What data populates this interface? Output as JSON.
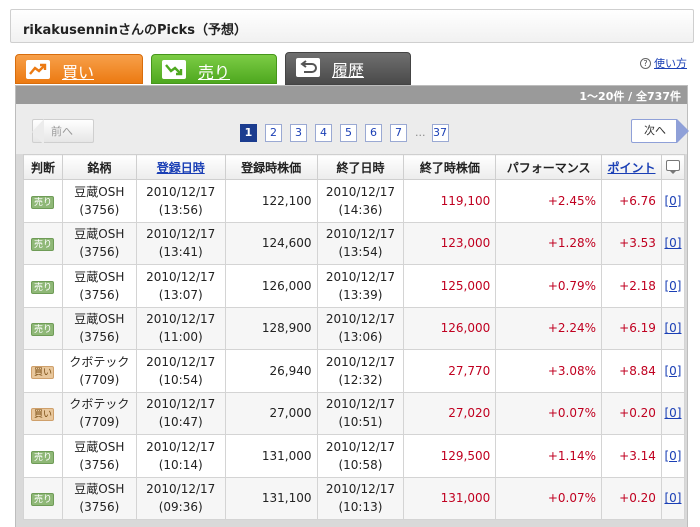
{
  "page_title": "rikakusenninさんのPicks（予想）",
  "tabs": [
    {
      "label": "買い",
      "icon": "trend-up-icon"
    },
    {
      "label": "売り",
      "icon": "trend-down-icon"
    },
    {
      "label": "履歴",
      "icon": "history-return-icon"
    }
  ],
  "howto_label": "使い方",
  "result_count": "1～20件 / 全737件",
  "pager": {
    "prev_label": "前へ",
    "next_label": "次へ",
    "pages": [
      "1",
      "2",
      "3",
      "4",
      "5",
      "6",
      "7"
    ],
    "ellipsis": "...",
    "last_page": "37",
    "current_page": "1"
  },
  "table": {
    "headers": [
      "判断",
      "銘柄",
      "登録日時",
      "登録時株価",
      "終了日時",
      "終了時株価",
      "パフォーマンス",
      "ポイント",
      ""
    ],
    "rows": [
      {
        "judgment": "売り",
        "type": "sell",
        "name": "豆蔵OSH",
        "code": "(3756)",
        "reg_date": "2010/12/17",
        "reg_time": "(13:56)",
        "reg_price": "122,100",
        "end_date": "2010/12/17",
        "end_time": "(14:36)",
        "end_price": "119,100",
        "performance": "+2.45%",
        "points": "+6.76",
        "comments": "[0]"
      },
      {
        "judgment": "売り",
        "type": "sell",
        "name": "豆蔵OSH",
        "code": "(3756)",
        "reg_date": "2010/12/17",
        "reg_time": "(13:41)",
        "reg_price": "124,600",
        "end_date": "2010/12/17",
        "end_time": "(13:54)",
        "end_price": "123,000",
        "performance": "+1.28%",
        "points": "+3.53",
        "comments": "[0]"
      },
      {
        "judgment": "売り",
        "type": "sell",
        "name": "豆蔵OSH",
        "code": "(3756)",
        "reg_date": "2010/12/17",
        "reg_time": "(13:07)",
        "reg_price": "126,000",
        "end_date": "2010/12/17",
        "end_time": "(13:39)",
        "end_price": "125,000",
        "performance": "+0.79%",
        "points": "+2.18",
        "comments": "[0]"
      },
      {
        "judgment": "売り",
        "type": "sell",
        "name": "豆蔵OSH",
        "code": "(3756)",
        "reg_date": "2010/12/17",
        "reg_time": "(11:00)",
        "reg_price": "128,900",
        "end_date": "2010/12/17",
        "end_time": "(13:06)",
        "end_price": "126,000",
        "performance": "+2.24%",
        "points": "+6.19",
        "comments": "[0]"
      },
      {
        "judgment": "買い",
        "type": "buy",
        "name": "クボテック",
        "code": "(7709)",
        "reg_date": "2010/12/17",
        "reg_time": "(10:54)",
        "reg_price": "26,940",
        "end_date": "2010/12/17",
        "end_time": "(12:32)",
        "end_price": "27,770",
        "performance": "+3.08%",
        "points": "+8.84",
        "comments": "[0]"
      },
      {
        "judgment": "買い",
        "type": "buy",
        "name": "クボテック",
        "code": "(7709)",
        "reg_date": "2010/12/17",
        "reg_time": "(10:47)",
        "reg_price": "27,000",
        "end_date": "2010/12/17",
        "end_time": "(10:51)",
        "end_price": "27,020",
        "performance": "+0.07%",
        "points": "+0.20",
        "comments": "[0]"
      },
      {
        "judgment": "売り",
        "type": "sell",
        "name": "豆蔵OSH",
        "code": "(3756)",
        "reg_date": "2010/12/17",
        "reg_time": "(10:14)",
        "reg_price": "131,000",
        "end_date": "2010/12/17",
        "end_time": "(10:58)",
        "end_price": "129,500",
        "performance": "+1.14%",
        "points": "+3.14",
        "comments": "[0]"
      },
      {
        "judgment": "売り",
        "type": "sell",
        "name": "豆蔵OSH",
        "code": "(3756)",
        "reg_date": "2010/12/17",
        "reg_time": "(09:36)",
        "reg_price": "131,100",
        "end_date": "2010/12/17",
        "end_time": "(10:13)",
        "end_price": "131,000",
        "performance": "+0.07%",
        "points": "+0.20",
        "comments": "[0]"
      }
    ]
  },
  "colors": {
    "buy_tab": "#ec7a12",
    "sell_tab": "#4ea81f",
    "history_tab": "#4a4a4a",
    "link": "#1a3fb5",
    "price_red": "#c00020",
    "active_page": "#1b3c8f"
  }
}
